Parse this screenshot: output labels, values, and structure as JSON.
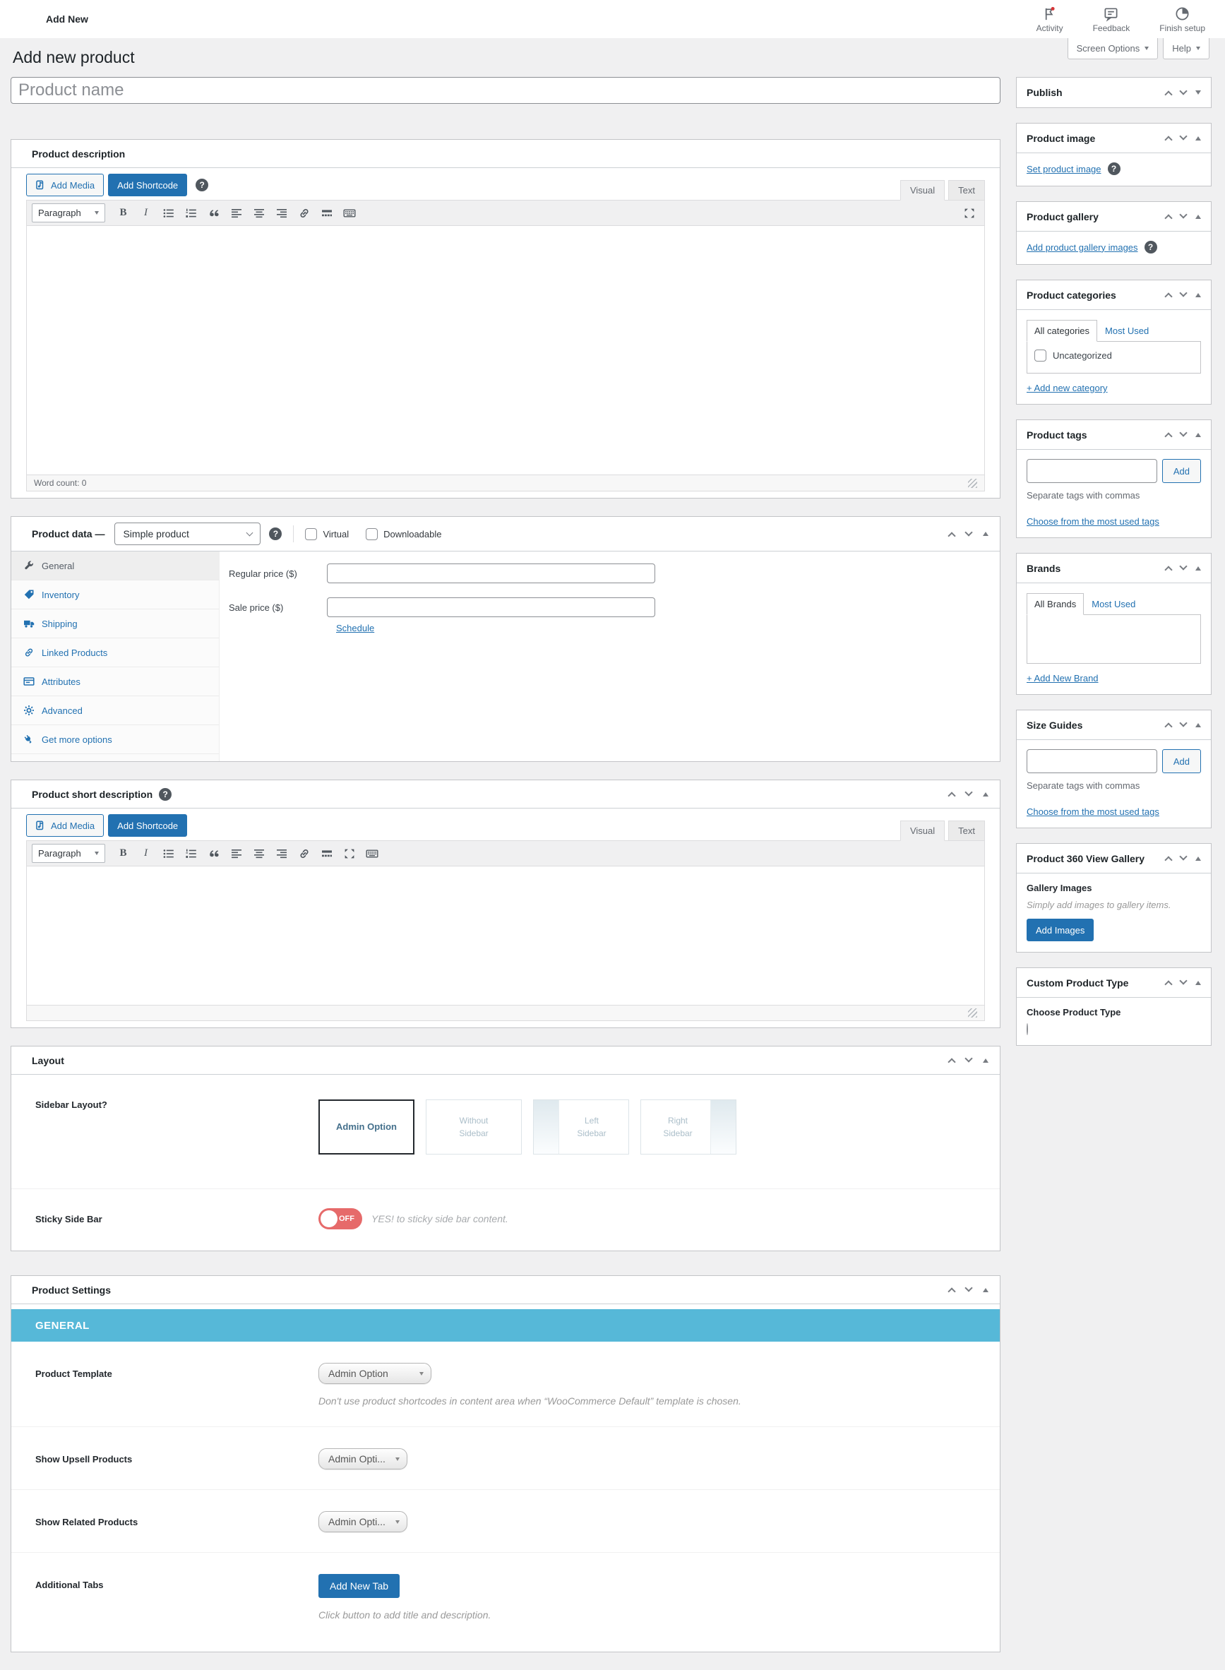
{
  "topbar": {
    "title": "Add New",
    "activity": "Activity",
    "feedback": "Feedback",
    "finish_setup": "Finish setup"
  },
  "screen": {
    "screen_options": "Screen Options",
    "help": "Help"
  },
  "page": {
    "title": "Add new product",
    "product_name_placeholder": "Product name"
  },
  "editor": {
    "add_media": "Add Media",
    "add_shortcode": "Add Shortcode",
    "visual": "Visual",
    "text": "Text",
    "paragraph": "Paragraph",
    "word_count": "Word count: 0",
    "help_glyph": "?"
  },
  "description_box": {
    "title": "Product description"
  },
  "short_description_box": {
    "title": "Product short description"
  },
  "product_data": {
    "title": "Product data —",
    "type_value": "Simple product",
    "virtual_label": "Virtual",
    "downloadable_label": "Downloadable",
    "tabs": [
      {
        "label": "General"
      },
      {
        "label": "Inventory"
      },
      {
        "label": "Shipping"
      },
      {
        "label": "Linked Products"
      },
      {
        "label": "Attributes"
      },
      {
        "label": "Advanced"
      },
      {
        "label": "Get more options"
      }
    ],
    "general": {
      "regular_price_label": "Regular price ($)",
      "sale_price_label": "Sale price ($)",
      "schedule_link": "Schedule"
    }
  },
  "layout_box": {
    "title": "Layout",
    "sidebar_layout_label": "Sidebar Layout?",
    "options": [
      {
        "label": "Admin Option"
      },
      {
        "label": "Without Sidebar"
      },
      {
        "label": "Left Sidebar"
      },
      {
        "label": "Right Sidebar"
      }
    ],
    "sticky_label": "Sticky Side Bar",
    "toggle_state": "OFF",
    "sticky_hint": "YES! to sticky side bar content."
  },
  "product_settings": {
    "title": "Product Settings",
    "banner": "GENERAL",
    "template_label": "Product Template",
    "template_value": "Admin Option",
    "template_note": "Don't use product shortcodes in content area when “WooCommerce Default” template is chosen.",
    "upsell_label": "Show Upsell Products",
    "upsell_value": "Admin Opti...",
    "related_label": "Show Related Products",
    "related_value": "Admin Opti...",
    "tabs_label": "Additional Tabs",
    "tabs_button": "Add New Tab",
    "tabs_note": "Click button to add title and description."
  },
  "sidebar": {
    "publish": {
      "title": "Publish"
    },
    "product_image": {
      "title": "Product image",
      "link": "Set product image"
    },
    "product_gallery": {
      "title": "Product gallery",
      "link": "Add product gallery images"
    },
    "categories": {
      "title": "Product categories",
      "tab_all": "All categories",
      "tab_most": "Most Used",
      "item": "Uncategorized",
      "add_link": "+ Add new category"
    },
    "tags": {
      "title": "Product tags",
      "add_button": "Add",
      "hint": "Separate tags with commas",
      "choose_link": "Choose from the most used tags"
    },
    "brands": {
      "title": "Brands",
      "tab_all": "All Brands",
      "tab_most": "Most Used",
      "add_link": "+ Add New Brand"
    },
    "size_guides": {
      "title": "Size Guides",
      "add_button": "Add",
      "hint": "Separate tags with commas",
      "choose_link": "Choose from the most used tags"
    },
    "gallery_360": {
      "title": "Product 360 View Gallery",
      "subtitle": "Gallery Images",
      "hint": "Simply add images to gallery items.",
      "button": "Add Images"
    },
    "custom_type": {
      "title": "Custom Product Type",
      "subtitle": "Choose Product Type"
    }
  },
  "colors": {
    "accent_blue": "#2271b1",
    "banner_blue": "#56b8d8",
    "toggle_off_red": "#e66a6a",
    "page_bg": "#f0f0f1"
  }
}
